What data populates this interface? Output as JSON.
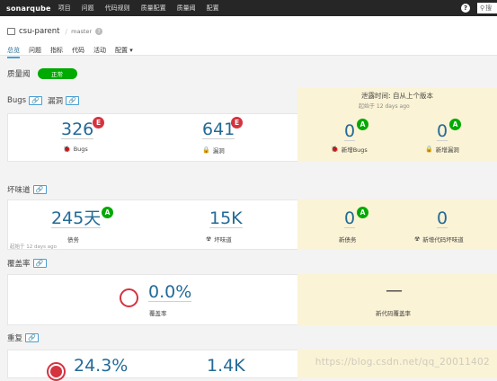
{
  "topbar": {
    "logo": "sonarqube",
    "nav": [
      "项目",
      "问题",
      "代码规则",
      "质量配置",
      "质量阈",
      "配置"
    ],
    "help": "?",
    "search_placeholder": "搜"
  },
  "project": {
    "name": "csu-parent",
    "separator": "/",
    "branch": "master",
    "help": "?"
  },
  "tabs": [
    "总览",
    "问题",
    "指标",
    "代码",
    "活动",
    "配置 ▾"
  ],
  "quality_gate": {
    "label": "质量阈",
    "status": "正常"
  },
  "leak_period": {
    "title": "泄露时间: 自从上个版本",
    "since": "起始于 12 days ago"
  },
  "bugs_section": {
    "title_bugs": "Bugs",
    "title_vuln": "漏洞",
    "bugs": {
      "value": "326",
      "rating": "E",
      "label": "Bugs"
    },
    "vulns": {
      "value": "641",
      "rating": "E",
      "label": "漏洞"
    },
    "new_bugs": {
      "value": "0",
      "rating": "A",
      "label": "新增Bugs"
    },
    "new_vulns": {
      "value": "0",
      "rating": "A",
      "label": "新增漏洞"
    }
  },
  "smells_section": {
    "title": "坏味道",
    "debt": {
      "value": "245天",
      "rating": "A",
      "label": "债务"
    },
    "smells": {
      "value": "15K",
      "label": "坏味道"
    },
    "new_debt": {
      "value": "0",
      "rating": "A",
      "label": "新债务"
    },
    "new_smells": {
      "value": "0",
      "label": "新增代码坏味道"
    },
    "since": "起始于 12 days ago"
  },
  "coverage_section": {
    "title": "覆盖率",
    "coverage": {
      "value": "0.0%",
      "label": "覆盖率"
    },
    "new_coverage": {
      "value": "—",
      "label": "新代码覆盖率"
    }
  },
  "dup_section": {
    "title": "重复",
    "dup": {
      "value": "24.3%"
    },
    "dup_lines": {
      "value": "1.4K"
    }
  },
  "icons": {
    "link": "link-icon",
    "bug": "bug-icon",
    "lock": "lock-icon",
    "smell": "radiation-icon",
    "help": "question-icon"
  },
  "colors": {
    "accent": "#4b9fd5",
    "rating_e": "#d4333f",
    "rating_a": "#00aa00",
    "leak_bg": "#fbf3d5",
    "topbar": "#262626"
  },
  "watermark": "https://blog.csdn.net/qq_20011402"
}
